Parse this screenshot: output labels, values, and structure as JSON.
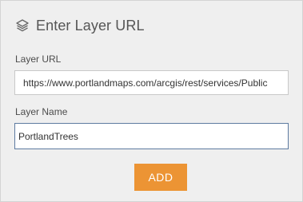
{
  "header": {
    "icon": "layers-icon",
    "title": "Enter Layer URL"
  },
  "form": {
    "url_label": "Layer URL",
    "url_value": "https://www.portlandmaps.com/arcgis/rest/services/Public",
    "name_label": "Layer Name",
    "name_value": "PortlandTrees",
    "submit_label": "ADD"
  },
  "colors": {
    "panel_background": "#efefef",
    "accent_button": "#ec9434",
    "focused_border": "#5d7ba0"
  }
}
